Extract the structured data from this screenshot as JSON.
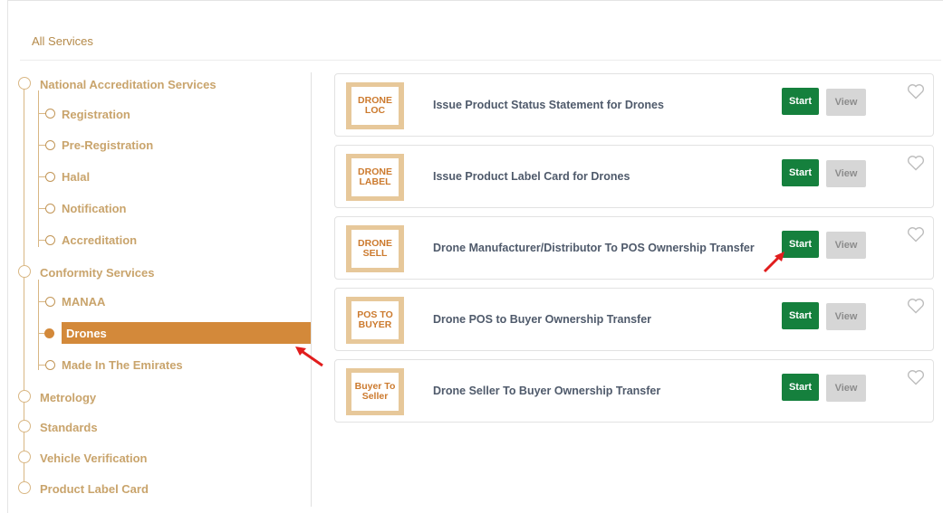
{
  "breadcrumb": "All Services",
  "sidebar": {
    "groups": [
      {
        "label": "National Accreditation Services"
      },
      {
        "label": "Conformity Services"
      },
      {
        "label": "Metrology"
      },
      {
        "label": "Standards"
      },
      {
        "label": "Vehicle Verification"
      },
      {
        "label": "Product Label Card"
      }
    ],
    "nas_items": [
      "Registration",
      "Pre-Registration",
      "Halal",
      "Notification",
      "Accreditation"
    ],
    "conformity_items": [
      "MANAA",
      "Drones",
      "Made In The Emirates"
    ],
    "active_item": "Drones"
  },
  "services": [
    {
      "badge": "DRONE\nLOC",
      "title": "Issue Product Status Statement for Drones",
      "start": "Start",
      "view": "View"
    },
    {
      "badge": "DRONE\nLABEL",
      "title": "Issue Product Label Card for Drones",
      "start": "Start",
      "view": "View"
    },
    {
      "badge": "DRONE\nSELL",
      "title": "Drone Manufacturer/Distributor To POS Ownership Transfer",
      "start": "Start",
      "view": "View"
    },
    {
      "badge": "POS TO\nBUYER",
      "title": "Drone POS to Buyer Ownership Transfer",
      "start": "Start",
      "view": "View"
    },
    {
      "badge": "Buyer To\nSeller",
      "title": "Drone Seller To Buyer Ownership Transfer",
      "start": "Start",
      "view": "View"
    }
  ],
  "colors": {
    "accent": "#d3893a",
    "start_button": "#15803d",
    "view_button": "#d6d6d6",
    "annotation_arrow": "#e11d1d"
  },
  "icons": [
    "heart-outline-icon",
    "red-arrow-annotation"
  ]
}
